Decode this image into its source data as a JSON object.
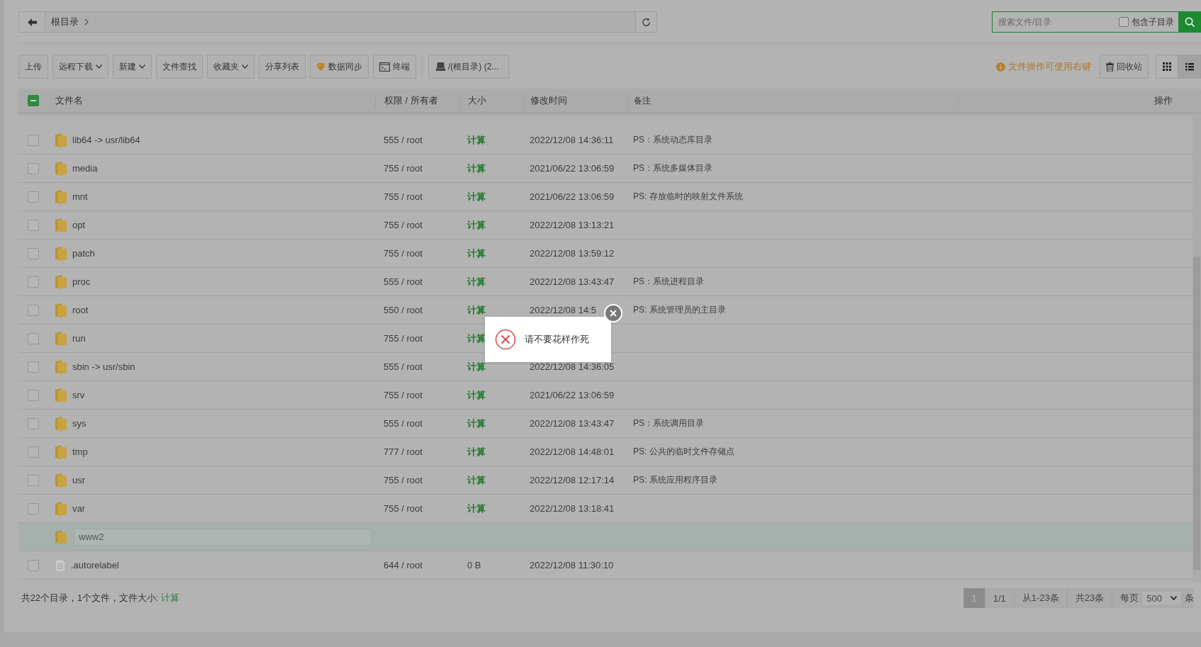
{
  "breadcrumb": {
    "items": [
      "根目录"
    ]
  },
  "search": {
    "placeholder": "搜索文件/目录",
    "include_subdirs": {
      "label": "包含子目录",
      "checked": false
    }
  },
  "toolbar": [
    {
      "label": "上传",
      "kind": "plain"
    },
    {
      "label": "远程下载",
      "kind": "dropdown"
    },
    {
      "label": "新建",
      "kind": "dropdown"
    },
    {
      "label": "文件查找",
      "kind": "plain"
    },
    {
      "label": "收藏夹",
      "kind": "dropdown"
    },
    {
      "label": "分享列表",
      "kind": "plain"
    },
    {
      "label": "数据同步",
      "kind": "gem"
    },
    {
      "label": "终端",
      "kind": "terminal"
    },
    {
      "label": "/(根目录) (2...",
      "kind": "disk"
    }
  ],
  "hint": "文件操作可使用右键",
  "recycle": "回收站",
  "views": [
    {
      "kind": "grid",
      "selected": false
    },
    {
      "kind": "list",
      "selected": true
    }
  ],
  "table": {
    "select_all_partial": true,
    "columns": [
      "文件名",
      "权限 / 所有者",
      "大小",
      "修改时间",
      "备注",
      "操作"
    ],
    "rows": [
      {
        "kind": "folder",
        "name": "lib64 -> usr/lib64",
        "perms": "555 / root",
        "size": "计算",
        "size_link": true,
        "time": "2022/12/08 14:36:11",
        "remark": "PS：系统动态库目录",
        "checked": false
      },
      {
        "kind": "folder",
        "name": "media",
        "perms": "755 / root",
        "size": "计算",
        "size_link": true,
        "time": "2021/06/22 13:06:59",
        "remark": "PS：系统多媒体目录",
        "checked": false
      },
      {
        "kind": "folder",
        "name": "mnt",
        "perms": "755 / root",
        "size": "计算",
        "size_link": true,
        "time": "2021/06/22 13:06:59",
        "remark": "PS: 存放临时的映射文件系统",
        "checked": false
      },
      {
        "kind": "folder",
        "name": "opt",
        "perms": "755 / root",
        "size": "计算",
        "size_link": true,
        "time": "2022/12/08 13:13:21",
        "checked": false
      },
      {
        "kind": "folder",
        "name": "patch",
        "perms": "755 / root",
        "size": "计算",
        "size_link": true,
        "time": "2022/12/08 13:59:12",
        "checked": false
      },
      {
        "kind": "folder",
        "name": "proc",
        "perms": "555 / root",
        "size": "计算",
        "size_link": true,
        "time": "2022/12/08 13:43:47",
        "remark": "PS：系统进程目录",
        "checked": false
      },
      {
        "kind": "folder",
        "name": "root",
        "perms": "550 / root",
        "size": "计算",
        "size_link": true,
        "time": "2022/12/08 14:5",
        "remark": "PS: 系统管理员的主目录",
        "checked": false
      },
      {
        "kind": "folder",
        "name": "run",
        "perms": "755 / root",
        "size": "计算",
        "size_link": true,
        "checked": false
      },
      {
        "kind": "folder",
        "name": "sbin -> usr/sbin",
        "perms": "555 / root",
        "size": "计算",
        "size_link": true,
        "time": "2022/12/08 14:36:05",
        "checked": false
      },
      {
        "kind": "folder",
        "name": "srv",
        "perms": "755 / root",
        "size": "计算",
        "size_link": true,
        "time": "2021/06/22 13:06:59",
        "checked": false
      },
      {
        "kind": "folder",
        "name": "sys",
        "perms": "555 / root",
        "size": "计算",
        "size_link": true,
        "time": "2022/12/08 13:43:47",
        "remark": "PS：系统调用目录",
        "checked": false
      },
      {
        "kind": "folder",
        "name": "tmp",
        "perms": "777 / root",
        "size": "计算",
        "size_link": true,
        "time": "2022/12/08 14:48:01",
        "remark": "PS: 公共的临时文件存储点",
        "checked": false
      },
      {
        "kind": "folder",
        "name": "usr",
        "perms": "755 / root",
        "size": "计算",
        "size_link": true,
        "time": "2022/12/08 12:17:14",
        "remark": "PS: 系统应用程序目录",
        "checked": false
      },
      {
        "kind": "folder",
        "name": "var",
        "perms": "755 / root",
        "size": "计算",
        "size_link": true,
        "time": "2022/12/08 13:18:41",
        "checked": false
      },
      {
        "kind": "editing",
        "name": "www2"
      },
      {
        "kind": "file",
        "name": ".autorelabel",
        "perms": "644 / root",
        "size": "0 B",
        "size_link": false,
        "time": "2022/12/08 11:30:10",
        "checked": false
      }
    ]
  },
  "footer": {
    "summary": "共22个目录，1个文件，文件大小: ",
    "summary_link": "计算"
  },
  "pagination": {
    "pages": [
      {
        "label": "1",
        "selected": true
      }
    ],
    "info": [
      "1/1",
      "从1-23条",
      "共23条"
    ],
    "per_page_label": "每页",
    "per_page": "500",
    "unit": "条"
  },
  "toast": {
    "message": "请不要花样作死"
  }
}
